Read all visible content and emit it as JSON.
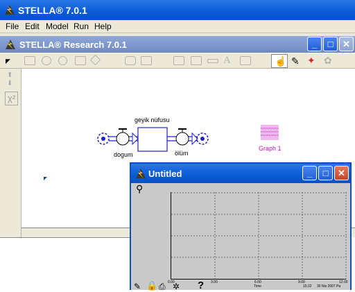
{
  "app": {
    "title": "STELLA® 7.0.1"
  },
  "menu": [
    "File",
    "Edit",
    "Model",
    "Run",
    "Help"
  ],
  "model_window": {
    "title": "STELLA® Research 7.0.1"
  },
  "diagram": {
    "stock_label": "geyik nüfusu",
    "inflow_label": "dogum",
    "outflow_label": "ölüm",
    "graph_label": "Graph 1"
  },
  "graph_window": {
    "title": "Untitled",
    "x_ticks": [
      "0.00",
      "3.00",
      "6.00",
      "9.00",
      "12.00"
    ],
    "x_axis_label": "Time",
    "footer_time": "15:22",
    "footer_date": "30 Nis 2007 Pa"
  },
  "colors": {
    "titlebar": "#0b5bd6",
    "flow_blue": "#2020c8",
    "graph_label": "#b51ab5"
  }
}
